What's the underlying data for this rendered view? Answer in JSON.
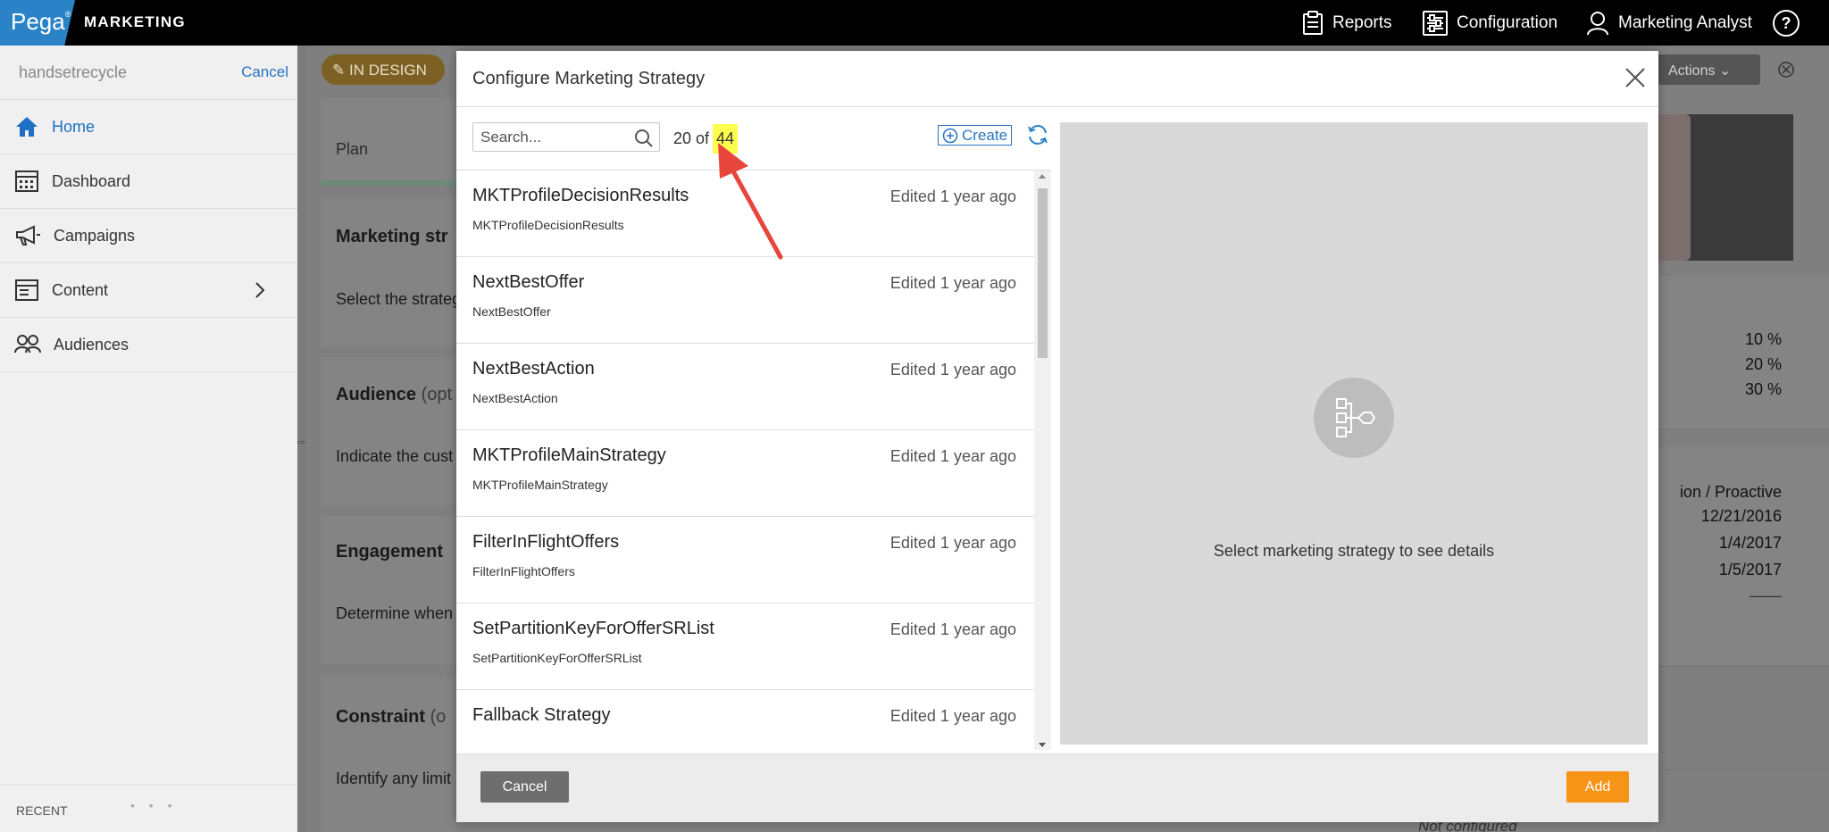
{
  "topbar": {
    "brand": "Pega",
    "brand_mark": "®",
    "brand_text": "MARKETING",
    "reports": "Reports",
    "configuration": "Configuration",
    "user": "Marketing Analyst",
    "help_icon": "help-icon"
  },
  "sidebar": {
    "title": "handsetrecycle",
    "cancel": "Cancel",
    "items": [
      {
        "label": "Home",
        "icon": "home-icon"
      },
      {
        "label": "Dashboard",
        "icon": "dashboard-icon"
      },
      {
        "label": "Campaigns",
        "icon": "megaphone-icon"
      },
      {
        "label": "Content",
        "icon": "content-icon"
      },
      {
        "label": "Audiences",
        "icon": "audiences-icon"
      }
    ],
    "recent": "RECENT",
    "dots": "• • •"
  },
  "background": {
    "badge": "IN DESIGN",
    "plan": "Plan",
    "marketing_strategy": "Marketing str",
    "select_strategy": "Select the strateg",
    "audience": "Audience",
    "audience_opt": "(opt",
    "indicate": "Indicate the cust",
    "engagement": "Engagement",
    "determine": "Determine when",
    "constraint": "Constraint",
    "constraint_opt": "(o",
    "identify": "Identify any limit",
    "actions": "Actions",
    "pct1": "10 %",
    "pct2": "20 %",
    "pct3": "30 %",
    "proactive": "ion  /  Proactive",
    "date1": "12/21/2016",
    "date2": "1/4/2017",
    "date3": "1/5/2017",
    "dash": "——",
    "not_configured": "Not configured"
  },
  "modal": {
    "title": "Configure Marketing Strategy",
    "search_placeholder": "Search...",
    "count_prefix": "20 of",
    "count_total": "44",
    "create": "Create",
    "rows": [
      {
        "name": "MKTProfileDecisionResults",
        "sub": "MKTProfileDecisionResults",
        "edited": "Edited 1 year ago"
      },
      {
        "name": "NextBestOffer",
        "sub": "NextBestOffer",
        "edited": "Edited 1 year ago"
      },
      {
        "name": "NextBestAction",
        "sub": "NextBestAction",
        "edited": "Edited 1 year ago"
      },
      {
        "name": "MKTProfileMainStrategy",
        "sub": "MKTProfileMainStrategy",
        "edited": "Edited 1 year ago"
      },
      {
        "name": "FilterInFlightOffers",
        "sub": "FilterInFlightOffers",
        "edited": "Edited 1 year ago"
      },
      {
        "name": "SetPartitionKeyForOfferSRList",
        "sub": "SetPartitionKeyForOfferSRList",
        "edited": "Edited 1 year ago"
      },
      {
        "name": "Fallback Strategy",
        "sub": "",
        "edited": "Edited 1 year ago"
      }
    ],
    "detail_text": "Select marketing strategy to see details",
    "cancel": "Cancel",
    "add": "Add"
  },
  "colors": {
    "brand": "#2a83c6",
    "link": "#2a73c0",
    "add_button": "#f79317",
    "highlight": "#ffff4d",
    "arrow": "#e8453c"
  }
}
